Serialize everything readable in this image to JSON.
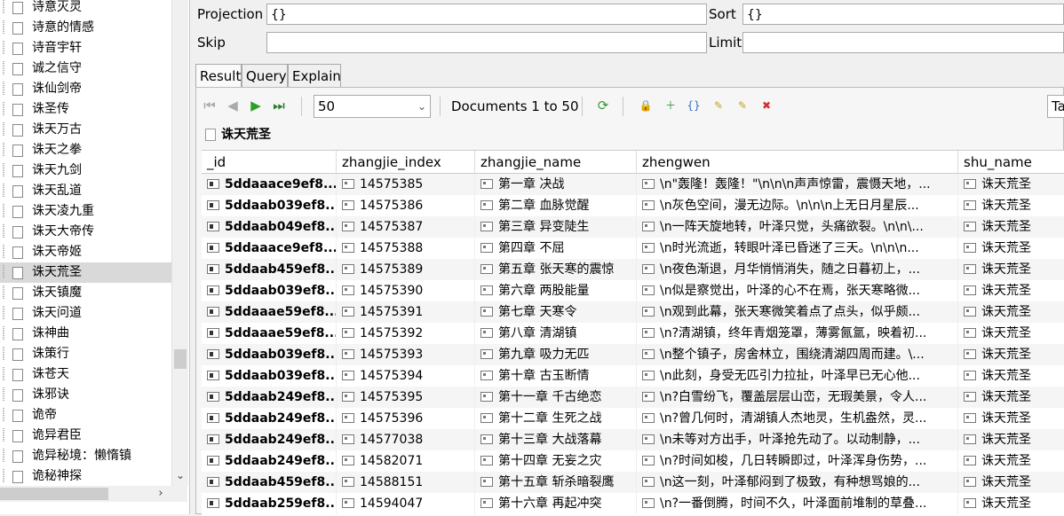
{
  "tree": {
    "items": [
      {
        "label": "诗意灭灵"
      },
      {
        "label": "诗意的情感"
      },
      {
        "label": "诗音宇轩"
      },
      {
        "label": "诚之信守"
      },
      {
        "label": "诛仙剑帝"
      },
      {
        "label": "诛圣传"
      },
      {
        "label": "诛天万古"
      },
      {
        "label": "诛天之拳"
      },
      {
        "label": "诛天九剑"
      },
      {
        "label": "诛天乱道"
      },
      {
        "label": "诛天凌九重"
      },
      {
        "label": "诛天大帝传"
      },
      {
        "label": "诛天帝姬"
      },
      {
        "label": "诛天荒圣",
        "selected": true
      },
      {
        "label": "诛天镇魔"
      },
      {
        "label": "诛天问道"
      },
      {
        "label": "诛神曲"
      },
      {
        "label": "诛策行"
      },
      {
        "label": "诛苍天"
      },
      {
        "label": "诛邪诀"
      },
      {
        "label": "诡帝"
      },
      {
        "label": "诡异君臣"
      },
      {
        "label": "诡异秘境：懒惰镇"
      },
      {
        "label": "诡秘神探"
      }
    ]
  },
  "query": {
    "projection_label": "Projection",
    "projection_value": "{}",
    "sort_label": "Sort",
    "sort_value": "{}",
    "skip_label": "Skip",
    "skip_value": "",
    "limit_label": "Limit",
    "limit_value": ""
  },
  "tabs": [
    {
      "label": "Result"
    },
    {
      "label": "Query"
    },
    {
      "label": "Explain"
    }
  ],
  "toolbar": {
    "page_size": "50",
    "doc_info": "Documents 1 to 50",
    "right_tab_label": "Ta"
  },
  "collection": {
    "name": "诛天荒圣"
  },
  "grid": {
    "columns": [
      "_id",
      "zhangjie_index",
      "zhangjie_name",
      "zhengwen",
      "shu_name"
    ],
    "rows": [
      {
        "id": "5ddaaace9ef8...",
        "idx": "14575385",
        "name": "第一章 决战",
        "text": "\\n\"轰隆！轰隆！\"\\n\\n\\n声声惊雷，震慑天地，...",
        "shu": "诛天荒圣"
      },
      {
        "id": "5ddaab039ef8...",
        "idx": "14575386",
        "name": "第二章 血脉觉醒",
        "text": "\\n灰色空间，漫无边际。\\n\\n\\n上无日月星辰...",
        "shu": "诛天荒圣"
      },
      {
        "id": "5ddaab049ef8...",
        "idx": "14575387",
        "name": "第三章 异变陡生",
        "text": "\\n一阵天旋地转，叶泽只觉，头痛欲裂。\\n\\n\\...",
        "shu": "诛天荒圣"
      },
      {
        "id": "5ddaaace9ef8...",
        "idx": "14575388",
        "name": "第四章 不屈",
        "text": "\\n时光流逝，转眼叶泽已昏迷了三天。\\n\\n\\n...",
        "shu": "诛天荒圣"
      },
      {
        "id": "5ddaab459ef8...",
        "idx": "14575389",
        "name": "第五章 张天寒的震惊",
        "text": "\\n夜色渐退，月华悄悄消失，随之日暮初上，...",
        "shu": "诛天荒圣"
      },
      {
        "id": "5ddaab039ef8...",
        "idx": "14575390",
        "name": "第六章 两股能量",
        "text": "\\n似是察觉出，叶泽的心不在焉，张天寒略微...",
        "shu": "诛天荒圣"
      },
      {
        "id": "5ddaaae59ef8...",
        "idx": "14575391",
        "name": "第七章 天寒令",
        "text": "\\n观到此幕，张天寒微笑着点了点头，似乎颇...",
        "shu": "诛天荒圣"
      },
      {
        "id": "5ddaaae59ef8...",
        "idx": "14575392",
        "name": "第八章 清湖镇",
        "text": "\\n?清湖镇，终年青烟笼罩，薄雾氤氲，映着初...",
        "shu": "诛天荒圣"
      },
      {
        "id": "5ddaab039ef8...",
        "idx": "14575393",
        "name": "第九章 吸力无匹",
        "text": "\\n整个镇子，房舍林立，围绕清湖四周而建。\\...",
        "shu": "诛天荒圣"
      },
      {
        "id": "5ddaab039ef8...",
        "idx": "14575394",
        "name": "第十章 古玉断情",
        "text": "\\n此刻，身受无匹引力拉扯，叶泽早已无心他...",
        "shu": "诛天荒圣"
      },
      {
        "id": "5ddaab249ef8...",
        "idx": "14575395",
        "name": "第十一章 千古绝恋",
        "text": "\\n?白雪纷飞，覆盖层层山峦，无瑕美景，令人...",
        "shu": "诛天荒圣"
      },
      {
        "id": "5ddaab249ef8...",
        "idx": "14575396",
        "name": "第十二章 生死之战",
        "text": "\\n?曾几何时，清湖镇人杰地灵，生机盎然，灵...",
        "shu": "诛天荒圣"
      },
      {
        "id": "5ddaab249ef8...",
        "idx": "14577038",
        "name": "第十三章 大战落幕",
        "text": "\\n未等对方出手，叶泽抢先动了。以动制静，...",
        "shu": "诛天荒圣"
      },
      {
        "id": "5ddaab249ef8...",
        "idx": "14582071",
        "name": "第十四章 无妄之灾",
        "text": "\\n?时间如梭，几日转瞬即过，叶泽浑身伤势，...",
        "shu": "诛天荒圣"
      },
      {
        "id": "5ddaab459ef8...",
        "idx": "14588151",
        "name": "第十五章 斩杀暗裂鹰",
        "text": "\\n这一刻，叶泽郁闷到了极致，有种想骂娘的...",
        "shu": "诛天荒圣"
      },
      {
        "id": "5ddaab259ef8...",
        "idx": "14594047",
        "name": "第十六章 再起冲突",
        "text": "\\n?一番倒腾，时间不久，叶泽面前堆制的草叠...",
        "shu": "诛天荒圣"
      }
    ]
  }
}
